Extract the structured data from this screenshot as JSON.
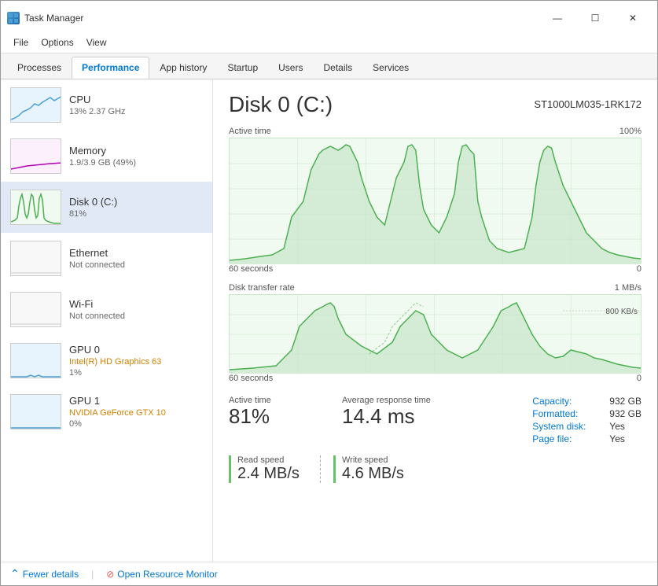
{
  "window": {
    "title": "Task Manager",
    "controls": {
      "minimize": "—",
      "maximize": "☐",
      "close": "✕"
    }
  },
  "menu": {
    "items": [
      "File",
      "Options",
      "View"
    ]
  },
  "tabs": [
    {
      "id": "processes",
      "label": "Processes"
    },
    {
      "id": "performance",
      "label": "Performance",
      "active": true
    },
    {
      "id": "app-history",
      "label": "App history"
    },
    {
      "id": "startup",
      "label": "Startup"
    },
    {
      "id": "users",
      "label": "Users"
    },
    {
      "id": "details",
      "label": "Details"
    },
    {
      "id": "services",
      "label": "Services"
    }
  ],
  "sidebar": {
    "items": [
      {
        "id": "cpu",
        "name": "CPU",
        "detail": "13%  2.37 GHz",
        "type": "cpu"
      },
      {
        "id": "memory",
        "name": "Memory",
        "detail": "1.9/3.9 GB (49%)",
        "type": "memory"
      },
      {
        "id": "disk0",
        "name": "Disk 0 (C:)",
        "detail": "81%",
        "type": "disk",
        "active": true
      },
      {
        "id": "ethernet",
        "name": "Ethernet",
        "detail": "Not connected",
        "type": "ethernet"
      },
      {
        "id": "wifi",
        "name": "Wi-Fi",
        "detail": "Not connected",
        "type": "wifi"
      },
      {
        "id": "gpu0",
        "name": "GPU 0",
        "detail_line1": "Intel(R) HD Graphics 63",
        "detail_line2": "1%",
        "type": "gpu0"
      },
      {
        "id": "gpu1",
        "name": "GPU 1",
        "detail_line1": "NVIDIA GeForce GTX 10",
        "detail_line2": "0%",
        "type": "gpu1"
      }
    ]
  },
  "detail": {
    "title": "Disk 0 (C:)",
    "model": "ST1000LM035-1RK172",
    "chart1": {
      "label": "Active time",
      "max_label": "100%",
      "time_label": "60 seconds",
      "zero_label": "0"
    },
    "chart2": {
      "label": "Disk transfer rate",
      "max_label": "1 MB/s",
      "max_label2": "800 KB/s",
      "time_label": "60 seconds",
      "zero_label": "0"
    },
    "stats": {
      "active_time_label": "Active time",
      "active_time_value": "81%",
      "response_time_label": "Average response time",
      "response_time_value": "14.4 ms",
      "read_speed_label": "Read speed",
      "read_speed_value": "2.4 MB/s",
      "write_speed_label": "Write speed",
      "write_speed_value": "4.6 MB/s"
    },
    "capacity": {
      "capacity_label": "Capacity:",
      "capacity_value": "932 GB",
      "formatted_label": "Formatted:",
      "formatted_value": "932 GB",
      "system_disk_label": "System disk:",
      "system_disk_value": "Yes",
      "page_file_label": "Page file:",
      "page_file_value": "Yes"
    }
  },
  "footer": {
    "fewer_details_label": "Fewer details",
    "open_monitor_label": "Open Resource Monitor"
  }
}
